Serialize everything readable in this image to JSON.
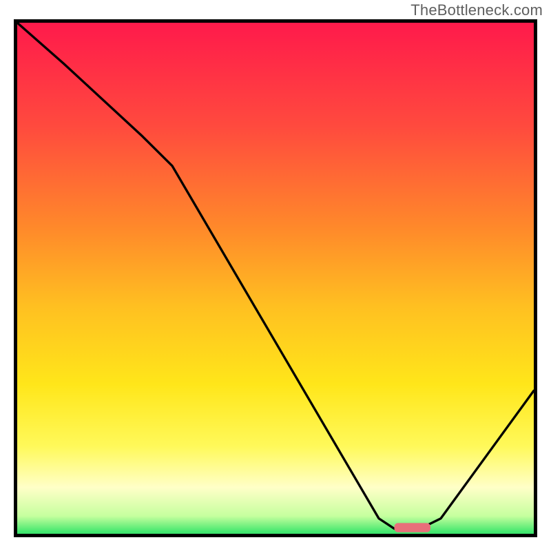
{
  "watermark": "TheBottleneck.com",
  "chart_data": {
    "type": "line",
    "title": "",
    "xlabel": "",
    "ylabel": "",
    "xlim": [
      0,
      100
    ],
    "ylim": [
      0,
      100
    ],
    "gradient_stops": [
      {
        "offset": 0.0,
        "color": "#ff1a4b"
      },
      {
        "offset": 0.2,
        "color": "#ff4a3e"
      },
      {
        "offset": 0.4,
        "color": "#ff8a2a"
      },
      {
        "offset": 0.55,
        "color": "#ffc021"
      },
      {
        "offset": 0.7,
        "color": "#ffe61a"
      },
      {
        "offset": 0.82,
        "color": "#fff95a"
      },
      {
        "offset": 0.9,
        "color": "#ffffc8"
      },
      {
        "offset": 0.955,
        "color": "#c6ff9e"
      },
      {
        "offset": 0.985,
        "color": "#45e86f"
      },
      {
        "offset": 1.0,
        "color": "#1dd66a"
      }
    ],
    "series": [
      {
        "name": "bottleneck-curve",
        "x": [
          0,
          9,
          24,
          30,
          70,
          73,
          78,
          82,
          100
        ],
        "values": [
          100,
          92,
          78,
          72,
          3,
          1,
          1,
          3,
          28
        ]
      }
    ],
    "marker": {
      "name": "optimal-range",
      "x_start": 73,
      "x_end": 80,
      "y": 1.2,
      "color": "#e86f7a"
    }
  }
}
